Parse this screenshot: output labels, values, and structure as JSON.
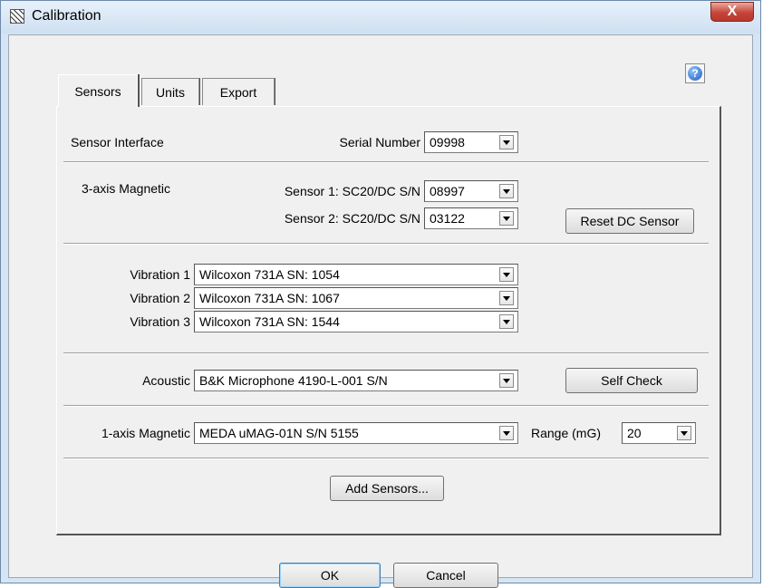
{
  "window": {
    "title": "Calibration",
    "close_label": "X"
  },
  "help": {
    "glyph": "?"
  },
  "tabs": [
    {
      "label": "Sensors",
      "active": true
    },
    {
      "label": "Units",
      "active": false
    },
    {
      "label": "Export",
      "active": false
    }
  ],
  "sensor_interface": {
    "label": "Sensor Interface",
    "serial_label": "Serial Number",
    "serial_value": "09998"
  },
  "magnetic3": {
    "label": "3-axis Magnetic",
    "sensor1_label": "Sensor 1: SC20/DC S/N",
    "sensor1_value": "08997",
    "sensor2_label": "Sensor 2: SC20/DC S/N",
    "sensor2_value": "03122",
    "reset_button": "Reset DC Sensor"
  },
  "vibration": [
    {
      "label": "Vibration 1",
      "value": "Wilcoxon 731A SN: 1054"
    },
    {
      "label": "Vibration 2",
      "value": "Wilcoxon 731A SN: 1067"
    },
    {
      "label": "Vibration 3",
      "value": "Wilcoxon 731A SN: 1544"
    }
  ],
  "acoustic": {
    "label": "Acoustic",
    "value": "B&K Microphone 4190-L-001 S/N",
    "self_check_button": "Self Check"
  },
  "magnetic1": {
    "label": "1-axis Magnetic",
    "value": "MEDA uMAG-01N S/N 5155",
    "range_label": "Range (mG)",
    "range_value": "20"
  },
  "add_sensors_button": "Add Sensors...",
  "footer": {
    "ok_label": "OK",
    "cancel_label": "Cancel"
  }
}
